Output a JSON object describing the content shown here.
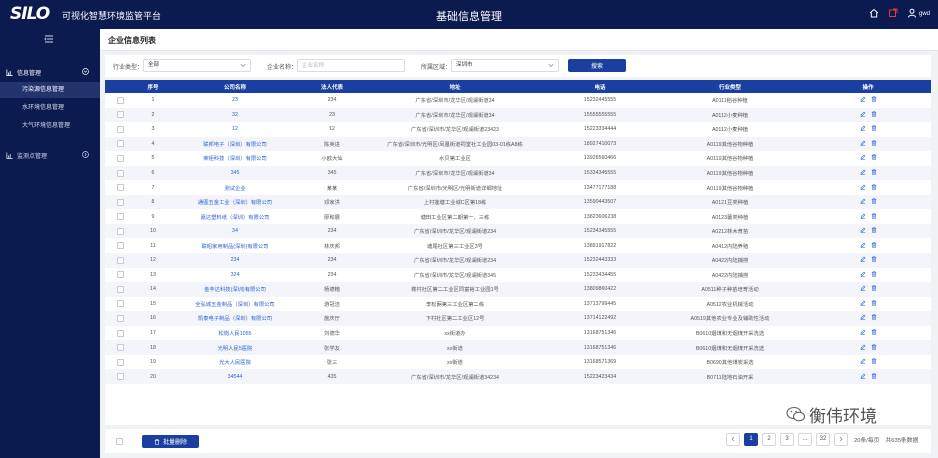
{
  "app": {
    "logo_text": "SILO",
    "title": "可视化智慧环境监管平台",
    "page_title": "基础信息管理",
    "user_name": "gwd"
  },
  "sidebar": {
    "groups": [
      {
        "label": "信息管理",
        "icon": "chart-icon",
        "expanded": true,
        "items": [
          {
            "label": "污染源信息管理",
            "active": true
          },
          {
            "label": "水环境信息管理",
            "active": false
          },
          {
            "label": "大气环境信息管理",
            "active": false
          }
        ]
      },
      {
        "label": "监测点管理",
        "icon": "chart-icon",
        "expanded": false,
        "items": []
      }
    ]
  },
  "main": {
    "header": "企业信息列表"
  },
  "filters": {
    "industry_label": "行业类型：",
    "industry_value": "全部",
    "company_label": "企业名称：",
    "company_placeholder": "企业名称",
    "region_label": "所属区域：",
    "region_value": "深圳市",
    "search_label": "搜索"
  },
  "table": {
    "columns": [
      "",
      "序号",
      "公司名称",
      "法人代表",
      "地址",
      "电话",
      "行业类型",
      "操作"
    ],
    "rows": [
      {
        "no": "1",
        "name": "23",
        "legal": "234",
        "address": "广东省/深圳市/龙华区/观澜街道34",
        "phone": "15232445555",
        "industry": "A0111稻谷种植"
      },
      {
        "no": "2",
        "name": "32",
        "legal": "23",
        "address": "广东省/深圳市/龙华区/观澜街道34",
        "phone": "15555555555",
        "industry": "A0112小麦种植"
      },
      {
        "no": "3",
        "name": "12",
        "legal": "12",
        "address": "广东省/深圳市/龙华区/观澜街道23423",
        "phone": "15223334444",
        "industry": "A0112小麦种植"
      },
      {
        "no": "4",
        "name": "联邦电子（深圳）有限公司",
        "legal": "陈英进",
        "address": "广东省/深圳市/光明区/凤凰街道祠堂社工业园03-01栋A8栋",
        "phone": "18927410073",
        "industry": "A0119其他谷物种植"
      },
      {
        "no": "5",
        "name": "荣钜科技（深圳）有限公司",
        "legal": "小欧大仙",
        "address": "水贝第工业区",
        "phone": "13926560466",
        "industry": "A0119其他谷物种植"
      },
      {
        "no": "6",
        "name": "345",
        "legal": "345",
        "address": "广东省/深圳市/龙华区/观澜街道34",
        "phone": "15334345555",
        "industry": "A0119其他谷物种植"
      },
      {
        "no": "7",
        "name": "测试企业",
        "legal": "某某",
        "address": "广东省/深圳市/光明区/光明街道详细地址",
        "phone": "13477177188",
        "industry": "A0119其他谷物种植"
      },
      {
        "no": "8",
        "name": "通图五金工业（深圳）有限公司",
        "legal": "邓家洪",
        "address": "上村莲塘工业城C区第18栋",
        "phone": "13590443507",
        "industry": "A0121豆类种植"
      },
      {
        "no": "9",
        "name": "嘉达塑料纸（深圳）有限公司",
        "legal": "廖和展",
        "address": "塘田工业区第二期第一、三栋",
        "phone": "13823606238",
        "industry": "A0123薯类种植"
      },
      {
        "no": "10",
        "name": "34",
        "legal": "234",
        "address": "广东省/深圳市/龙华区/观澜街道234",
        "phone": "15234345555",
        "industry": "A0212林木育苗"
      },
      {
        "no": "11",
        "name": "联昭家用制品(深圳)有限公司",
        "legal": "林庆邦",
        "address": "塘尾社区第三工业区3号",
        "phone": "13891917822",
        "industry": "A0412内陆养殖"
      },
      {
        "no": "12",
        "name": "234",
        "legal": "234",
        "address": "广东省/深圳市/龙华区/观澜街道234",
        "phone": "15232443333",
        "industry": "A0422内陆捕捞"
      },
      {
        "no": "13",
        "name": "324",
        "legal": "234",
        "address": "广东省/深圳市/龙华区/观澜街道345",
        "phone": "15233434455",
        "industry": "A0422内陆捕捞"
      },
      {
        "no": "14",
        "name": "金丰达科技(深圳)有限公司",
        "legal": "杨德楷",
        "address": "楼村社区第二工业区同富裕工业园1号",
        "phone": "13809860422",
        "industry": "A0511种子种苗培育活动"
      },
      {
        "no": "15",
        "name": "全弘城五金制品（深圳）有限公司",
        "legal": "游冠洁",
        "address": "李松蓢第三工业区第二栋",
        "phone": "13713799445",
        "industry": "A0512农业机械活动"
      },
      {
        "no": "16",
        "name": "凯泰电子制品（深圳）有限公司",
        "legal": "施庆厅",
        "address": "下村社区第二工业区12号",
        "phone": "13714122492",
        "industry": "A0519其他农业专业及辅助性活动"
      },
      {
        "no": "17",
        "name": "松岗人民1055",
        "legal": "刘德华",
        "address": "xx街道办",
        "phone": "13168751346",
        "industry": "B0610烟煤和无烟煤开采洗选"
      },
      {
        "no": "18",
        "name": "光明人民5医院",
        "legal": "张学友",
        "address": "xx街道",
        "phone": "13168751346",
        "industry": "B0610烟煤和无烟煤开采洗选"
      },
      {
        "no": "19",
        "name": "光大人民医院",
        "legal": "张三",
        "address": "xx街道",
        "phone": "13168571369",
        "industry": "B0690其他煤炭采选"
      },
      {
        "no": "20",
        "name": "34544",
        "legal": "435",
        "address": "广东省/深圳市/龙华区/观澜街道34234",
        "phone": "15223423434",
        "industry": "B0711陆地石油开采"
      }
    ]
  },
  "footer": {
    "batch_delete_label": "批量删除",
    "pages": [
      "1",
      "2",
      "3",
      "...",
      "32"
    ],
    "current_page": "1",
    "page_size": "20条/每页",
    "total": "共635条数据"
  },
  "watermark": {
    "text": "衡伟环境"
  },
  "colors": {
    "nav_bg": "#0b1a4f",
    "primary": "#1a3fa0",
    "link": "#2a63d4"
  }
}
